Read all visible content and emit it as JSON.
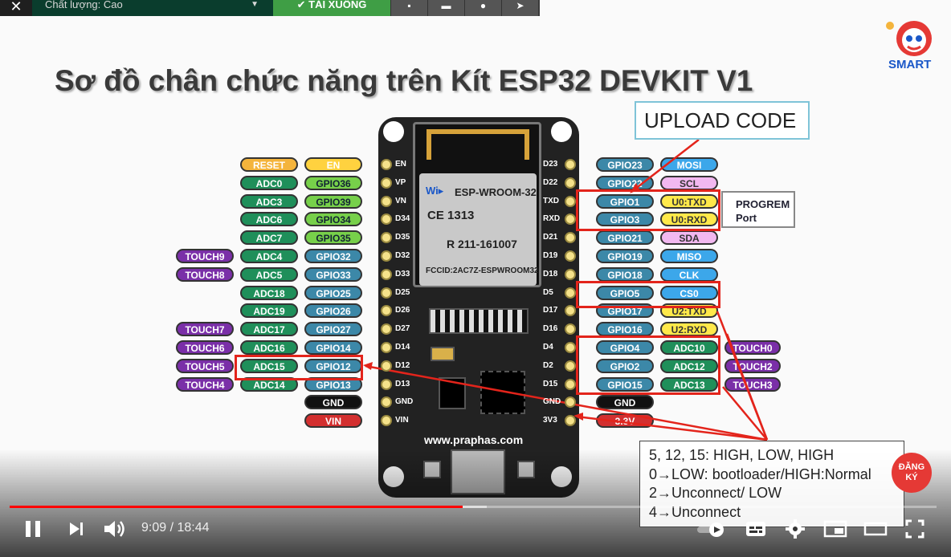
{
  "toolbar": {
    "close_label": "✕",
    "quality_label": "Chất lượng: Cao",
    "download_label": "✔ TẢI XUỐNG"
  },
  "slide": {
    "title": "Sơ đồ chân chức năng trên Kít ESP32 DEVKIT V1",
    "logo_text": "SMART",
    "upload_code": "UPLOAD CODE",
    "progrem_line1": "PROGREM",
    "progrem_line2": "Port",
    "website": "www.praphas.com",
    "module_name": "ESP-WROOM-32",
    "module_ce": "CE 1313",
    "module_cert": "R 211-161007",
    "module_fcc": "FCCID:2AC7Z-ESPWROOM32",
    "note_lines": [
      "5, 12, 15: HIGH, LOW, HIGH",
      "0→LOW: bootloader/HIGH:Normal",
      "2→Unconnect/ LOW",
      "4→Unconnect"
    ],
    "subscribe_label": "ĐĂNG KÝ",
    "left_pins": [
      {
        "board": "EN",
        "gpio": "EN",
        "adc": "RESET",
        "touch": ""
      },
      {
        "board": "VP",
        "gpio": "GPIO36",
        "adc": "ADC0",
        "touch": ""
      },
      {
        "board": "VN",
        "gpio": "GPIO39",
        "adc": "ADC3",
        "touch": ""
      },
      {
        "board": "D34",
        "gpio": "GPIO34",
        "adc": "ADC6",
        "touch": ""
      },
      {
        "board": "D35",
        "gpio": "GPIO35",
        "adc": "ADC7",
        "touch": ""
      },
      {
        "board": "D32",
        "gpio": "GPIO32",
        "adc": "ADC4",
        "touch": "TOUCH9"
      },
      {
        "board": "D33",
        "gpio": "GPIO33",
        "adc": "ADC5",
        "touch": "TOUCH8"
      },
      {
        "board": "D25",
        "gpio": "GPIO25",
        "adc": "ADC18",
        "touch": ""
      },
      {
        "board": "D26",
        "gpio": "GPIO26",
        "adc": "ADC19",
        "touch": ""
      },
      {
        "board": "D27",
        "gpio": "GPIO27",
        "adc": "ADC17",
        "touch": "TOUCH7"
      },
      {
        "board": "D14",
        "gpio": "GPIO14",
        "adc": "ADC16",
        "touch": "TOUCH6"
      },
      {
        "board": "D12",
        "gpio": "GPIO12",
        "adc": "ADC15",
        "touch": "TOUCH5"
      },
      {
        "board": "D13",
        "gpio": "GPIO13",
        "adc": "ADC14",
        "touch": "TOUCH4"
      },
      {
        "board": "GND",
        "gpio": "GND",
        "adc": "",
        "touch": ""
      },
      {
        "board": "VIN",
        "gpio": "VIN",
        "adc": "",
        "touch": ""
      }
    ],
    "right_pins": [
      {
        "board": "D23",
        "gpio": "GPIO23",
        "func": "MOSI",
        "extra": ""
      },
      {
        "board": "D22",
        "gpio": "GPIO22",
        "func": "SCL",
        "extra": ""
      },
      {
        "board": "TXD",
        "gpio": "GPIO1",
        "func": "U0:TXD",
        "extra": ""
      },
      {
        "board": "RXD",
        "gpio": "GPIO3",
        "func": "U0:RXD",
        "extra": ""
      },
      {
        "board": "D21",
        "gpio": "GPIO21",
        "func": "SDA",
        "extra": ""
      },
      {
        "board": "D19",
        "gpio": "GPIO19",
        "func": "MISO",
        "extra": ""
      },
      {
        "board": "D18",
        "gpio": "GPIO18",
        "func": "CLK",
        "extra": ""
      },
      {
        "board": "D5",
        "gpio": "GPIO5",
        "func": "CS0",
        "extra": ""
      },
      {
        "board": "D17",
        "gpio": "GPIO17",
        "func": "U2:TXD",
        "extra": ""
      },
      {
        "board": "D16",
        "gpio": "GPIO16",
        "func": "U2:RXD",
        "extra": ""
      },
      {
        "board": "D4",
        "gpio": "GPIO4",
        "func": "ADC10",
        "extra": "TOUCH0"
      },
      {
        "board": "D2",
        "gpio": "GPIO2",
        "func": "ADC12",
        "extra": "TOUCH2"
      },
      {
        "board": "D15",
        "gpio": "GPIO15",
        "func": "ADC13",
        "extra": "TOUCH3"
      },
      {
        "board": "GND",
        "gpio": "GND",
        "func": "",
        "extra": ""
      },
      {
        "board": "3V3",
        "gpio": "3.3V",
        "func": "",
        "extra": ""
      }
    ]
  },
  "colors": {
    "gpio": "#3c88a8",
    "adc": "#1f8f5a",
    "touch": "#7a2fa8",
    "reset": "#f4b43c",
    "en": "#ffd23f",
    "gnd": "#111111",
    "power": "#d32f2f",
    "spi": "#3ca7ea",
    "i2c": "#f2b8f0",
    "uart": "#ffe94a",
    "gpio_green": "#77d04a",
    "highlight": "#e3241b"
  },
  "player": {
    "time_display": "9:09 / 18:44",
    "played_fraction": 0.489,
    "buffered_fraction": 0.515,
    "play_pause_icon": "pause-icon",
    "next_icon": "next-icon",
    "volume_icon": "volume-icon",
    "autoplay_icon": "autoplay-toggle-icon",
    "subtitles_icon": "subtitles-icon",
    "settings_icon": "gear-icon",
    "miniplayer_icon": "miniplayer-icon",
    "theater_icon": "theater-icon",
    "fullscreen_icon": "fullscreen-icon"
  }
}
